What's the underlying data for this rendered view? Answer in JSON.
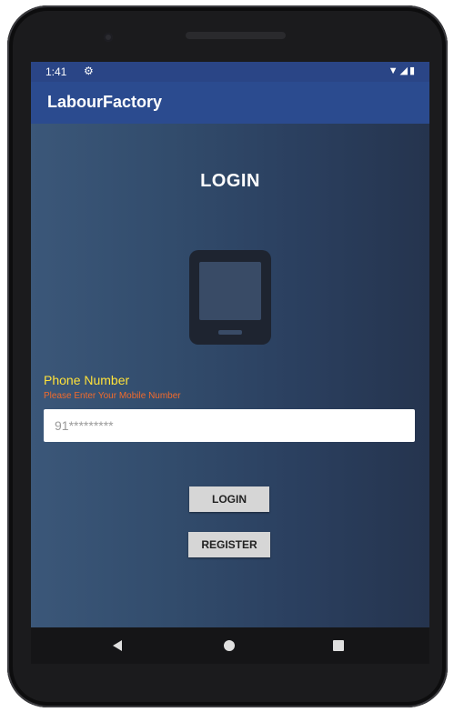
{
  "status_bar": {
    "time": "1:41",
    "settings_icon": "gear-icon",
    "right_icons": [
      "wifi-icon",
      "signal-icon",
      "battery-icon"
    ]
  },
  "app_bar": {
    "title": "LabourFactory",
    "color": "#2b4b8f"
  },
  "main": {
    "heading": "LOGIN",
    "illustration_icon": "smartphone-icon",
    "phone_label": "Phone Number",
    "phone_hint": "Please Enter Your Mobile Number",
    "phone_placeholder": "91*********",
    "phone_value": "",
    "login_button": "LOGIN",
    "register_button": "REGISTER"
  },
  "nav_bar": {
    "icons": [
      "back-icon",
      "home-icon",
      "recents-icon"
    ]
  },
  "colors": {
    "label_yellow": "#ffe23a",
    "hint_orange": "#f26b2c",
    "icon_dark": "#1e2430"
  }
}
